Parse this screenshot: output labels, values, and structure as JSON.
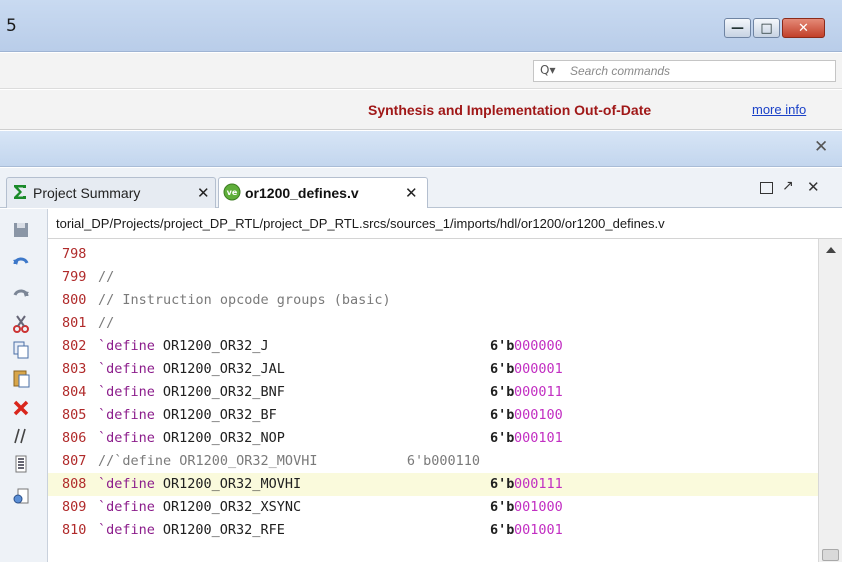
{
  "window": {
    "title": "5",
    "min_glyph": "—",
    "max_glyph": "□",
    "close_glyph": "✕"
  },
  "search": {
    "placeholder": "Search commands",
    "icon_glyph": "Q▾"
  },
  "status": {
    "message": "Synthesis and Implementation Out-of-Date",
    "link": "more info"
  },
  "panel": {
    "close_glyph": "✕"
  },
  "tabs": [
    {
      "label": "Project Summary",
      "icon": "sigma-icon",
      "close": "✕",
      "active": false
    },
    {
      "label": "or1200_defines.v",
      "icon": "verilog-file-icon",
      "close": "✕",
      "active": true
    }
  ],
  "tab_controls": {
    "maximize_glyph": "↗",
    "close_glyph": "✕"
  },
  "path": "torial_DP/Projects/project_DP_RTL/project_DP_RTL.srcs/sources_1/imports/hdl/or1200/or1200_defines.v",
  "toolbar_icons": [
    "save-icon",
    "undo-icon",
    "redo-icon",
    "cut-icon",
    "copy-icon",
    "paste-icon",
    "delete-icon",
    "comment-icon",
    "indent-icon",
    "find-replace-icon"
  ],
  "code_lines": [
    {
      "num": "798",
      "kw": "",
      "name": "",
      "width": "",
      "value": "",
      "comment": "",
      "highlight": false
    },
    {
      "num": "799",
      "kw": "",
      "name": "",
      "width": "",
      "value": "",
      "comment": "//",
      "highlight": false
    },
    {
      "num": "800",
      "kw": "",
      "name": "",
      "width": "",
      "value": "",
      "comment": "// Instruction opcode groups (basic)",
      "highlight": false
    },
    {
      "num": "801",
      "kw": "",
      "name": "",
      "width": "",
      "value": "",
      "comment": "//",
      "highlight": false
    },
    {
      "num": "802",
      "kw": "`define",
      "name": "OR1200_OR32_J",
      "width": "6'b",
      "value": "000000",
      "comment": "",
      "highlight": false
    },
    {
      "num": "803",
      "kw": "`define",
      "name": "OR1200_OR32_JAL",
      "width": "6'b",
      "value": "000001",
      "comment": "",
      "highlight": false
    },
    {
      "num": "804",
      "kw": "`define",
      "name": "OR1200_OR32_BNF",
      "width": "6'b",
      "value": "000011",
      "comment": "",
      "highlight": false
    },
    {
      "num": "805",
      "kw": "`define",
      "name": "OR1200_OR32_BF",
      "width": "6'b",
      "value": "000100",
      "comment": "",
      "highlight": false
    },
    {
      "num": "806",
      "kw": "`define",
      "name": "OR1200_OR32_NOP",
      "width": "6'b",
      "value": "000101",
      "comment": "",
      "highlight": false
    },
    {
      "num": "807",
      "kw": "",
      "name": "",
      "width": "",
      "value": "",
      "comment": "//`define OR1200_OR32_MOVHI           6'b000110",
      "highlight": false
    },
    {
      "num": "808",
      "kw": "`define",
      "name": "OR1200_OR32_MOVHI",
      "width": "6'b",
      "value": "000111",
      "comment": "",
      "highlight": true
    },
    {
      "num": "809",
      "kw": "`define",
      "name": "OR1200_OR32_XSYNC",
      "width": "6'b",
      "value": "001000",
      "comment": "",
      "highlight": false
    },
    {
      "num": "810",
      "kw": "`define",
      "name": "OR1200_OR32_RFE",
      "width": "6'b",
      "value": "001001",
      "comment": "",
      "highlight": false
    }
  ]
}
